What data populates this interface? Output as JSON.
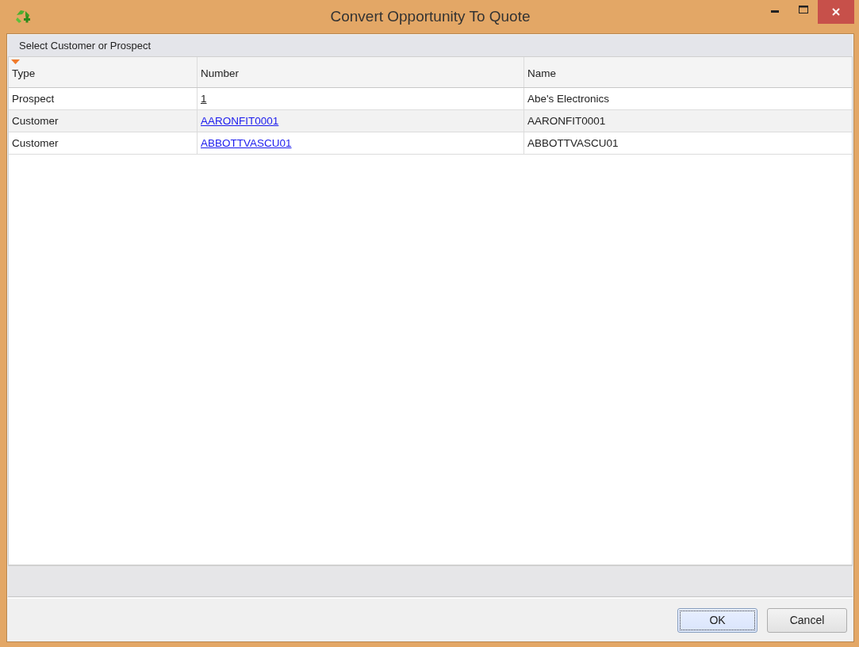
{
  "window": {
    "title": "Convert Opportunity To Quote"
  },
  "group": {
    "title": "Select Customer or Prospect"
  },
  "table": {
    "columns": [
      {
        "label": "Type",
        "sorted": true
      },
      {
        "label": "Number",
        "sorted": false
      },
      {
        "label": "Name",
        "sorted": false
      }
    ],
    "rows": [
      {
        "type": "Prospect",
        "number": "1",
        "name": "Abe's Electronics",
        "focused": true
      },
      {
        "type": "Customer",
        "number": "AARONFIT0001",
        "name": "AARONFIT0001",
        "focused": false
      },
      {
        "type": "Customer",
        "number": "ABBOTTVASCU01",
        "name": "ABBOTTVASCU01",
        "focused": false
      }
    ]
  },
  "buttons": [
    {
      "label": "OK",
      "default": true
    },
    {
      "label": "Cancel",
      "default": false
    }
  ]
}
